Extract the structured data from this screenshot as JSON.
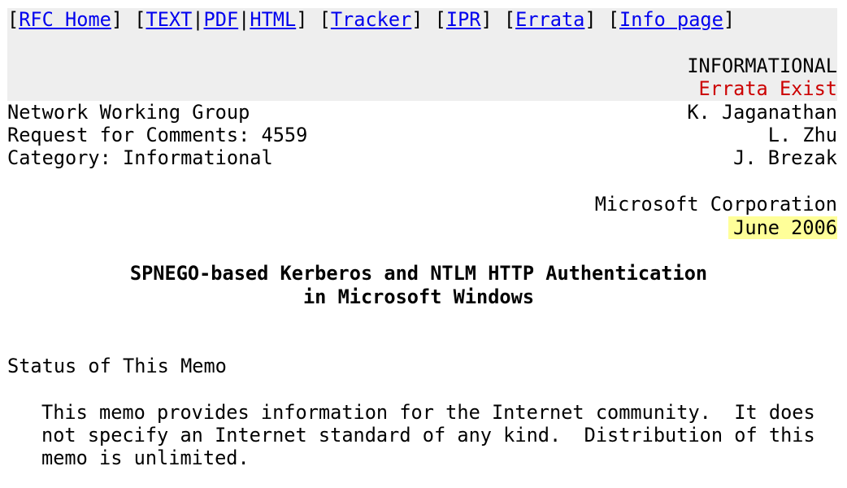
{
  "nav": {
    "rfc_home": "RFC Home",
    "text": "TEXT",
    "pdf": "PDF",
    "html": "HTML",
    "tracker": "Tracker",
    "ipr": "IPR",
    "errata": "Errata",
    "info_page": "Info page"
  },
  "status_banner": {
    "category": "INFORMATIONAL",
    "errata_notice": "Errata Exist"
  },
  "header": {
    "left": [
      "Network Working Group",
      "Request for Comments: 4559",
      "Category: Informational"
    ],
    "right": [
      "K. Jaganathan",
      "L. Zhu",
      "J. Brezak",
      "Microsoft Corporation",
      "June 2006"
    ]
  },
  "title": {
    "line1": "SPNEGO-based Kerberos and NTLM HTTP Authentication",
    "line2": "in Microsoft Windows"
  },
  "status_section": {
    "heading": "Status of This Memo",
    "paragraph": [
      "This memo provides information for the Internet community.  It does",
      "not specify an Internet standard of any kind.  Distribution of this",
      "memo is unlimited."
    ]
  },
  "colors": {
    "link": "#0000ee",
    "errata": "#cc0000",
    "banner_bg": "#eeeeee",
    "date_highlight": "#ffff99"
  }
}
